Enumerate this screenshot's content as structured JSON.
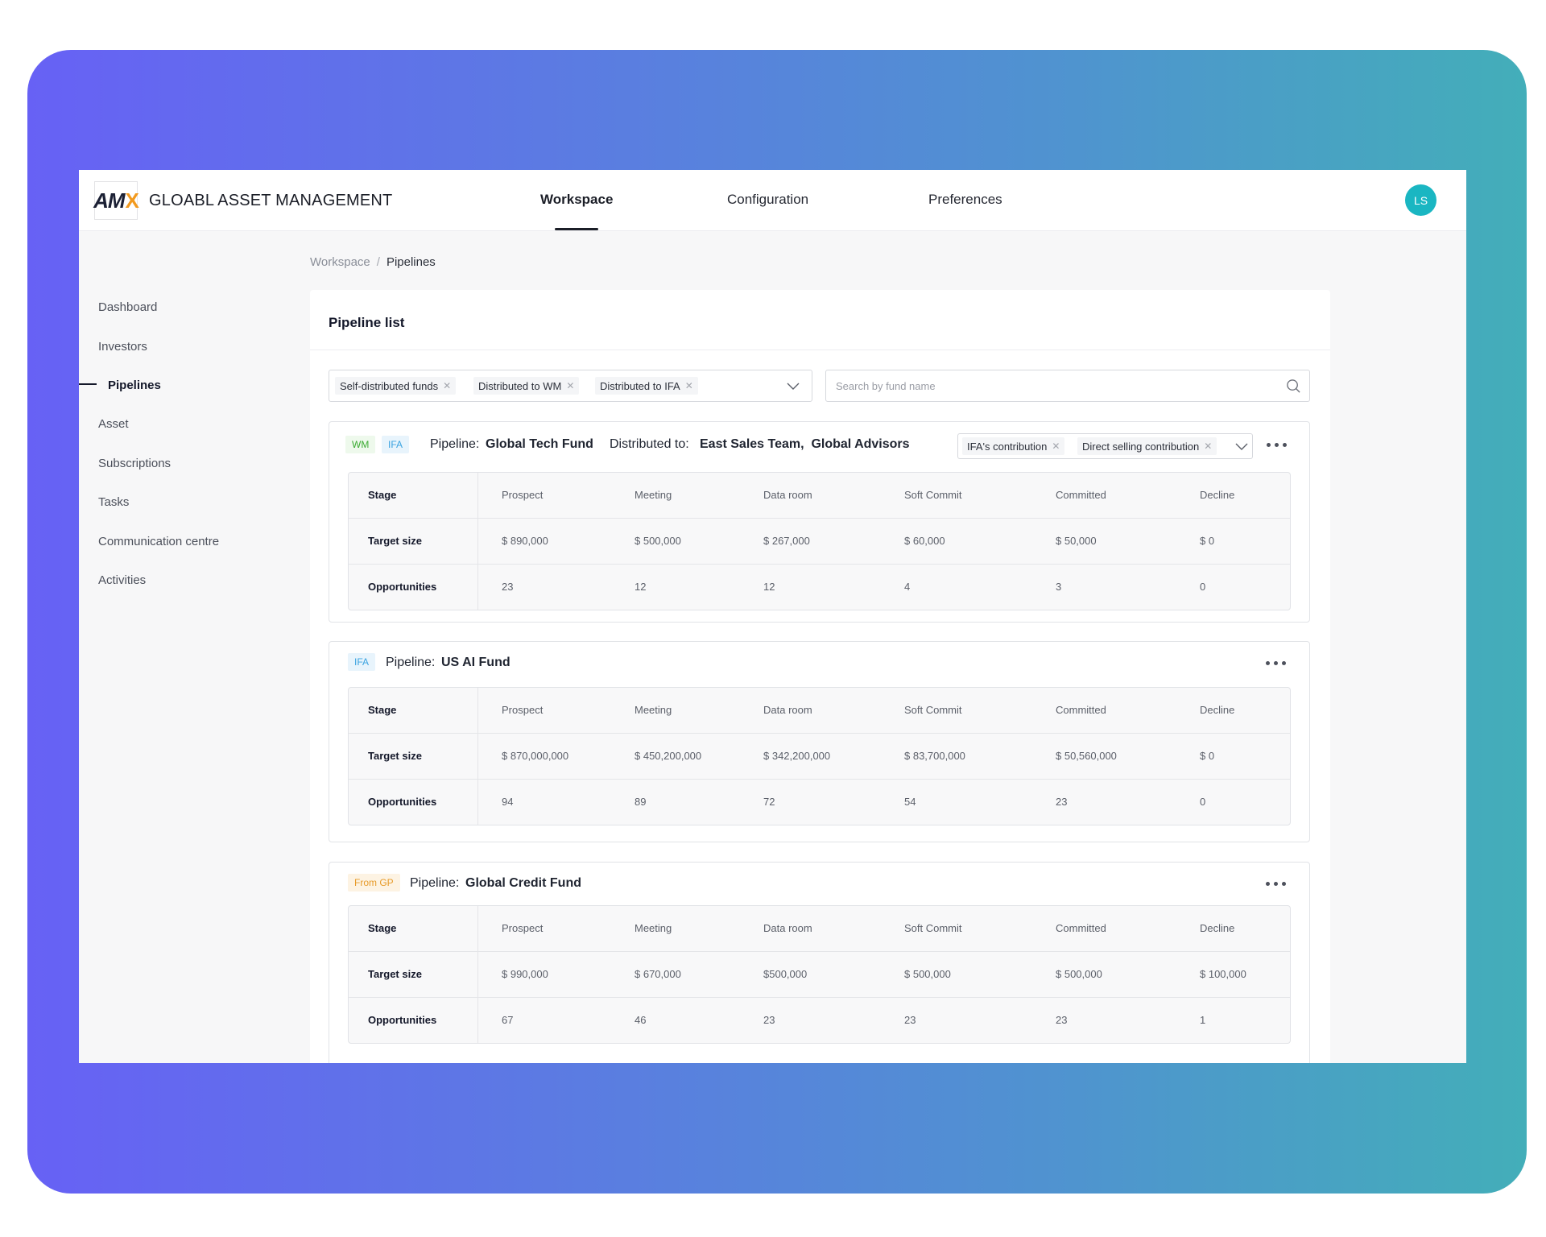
{
  "app": {
    "brand": "GLOABL ASSET MANAGEMENT",
    "logo_text": "AM",
    "logo_accent": "X",
    "avatar_initials": "LS"
  },
  "nav": {
    "tabs": [
      {
        "label": "Workspace",
        "active": true
      },
      {
        "label": "Configuration",
        "active": false
      },
      {
        "label": "Preferences",
        "active": false
      }
    ]
  },
  "sidebar": {
    "items": [
      {
        "label": "Dashboard"
      },
      {
        "label": "Investors"
      },
      {
        "label": "Pipelines",
        "active": true
      },
      {
        "label": "Asset"
      },
      {
        "label": "Subscriptions"
      },
      {
        "label": "Tasks"
      },
      {
        "label": "Communication centre"
      },
      {
        "label": "Activities"
      }
    ]
  },
  "breadcrumb": {
    "root": "Workspace",
    "separator": "/",
    "current": "Pipelines"
  },
  "main": {
    "title": "Pipeline list",
    "filters": {
      "chips": [
        "Self-distributed funds",
        "Distributed to WM",
        "Distributed to IFA"
      ]
    },
    "search": {
      "placeholder": "Search by fund name",
      "value": ""
    }
  },
  "pipelines": [
    {
      "tags": [
        "WM",
        "IFA"
      ],
      "pipeline_label": "Pipeline:",
      "name": "Global Tech Fund",
      "distributed_label": "Distributed to:",
      "distributed_to": "East Sales Team,  Global Advisors",
      "contribution_chips": [
        "IFA's contribution",
        "Direct selling contribution"
      ],
      "table": {
        "header": [
          "Stage",
          "Prospect",
          "Meeting",
          "Data room",
          "Soft Commit",
          "Committed",
          "Decline"
        ],
        "rows": [
          [
            "Target size",
            "$ 890,000",
            "$ 500,000",
            "$ 267,000",
            "$ 60,000",
            "$ 50,000",
            "$ 0"
          ],
          [
            "Opportunities",
            "23",
            "12",
            "12",
            "4",
            "3",
            "0"
          ]
        ]
      }
    },
    {
      "tags": [
        "IFA"
      ],
      "pipeline_label": "Pipeline:",
      "name": "US AI Fund",
      "table": {
        "header": [
          "Stage",
          "Prospect",
          "Meeting",
          "Data room",
          "Soft Commit",
          "Committed",
          "Decline"
        ],
        "rows": [
          [
            "Target size",
            "$ 870,000,000",
            "$ 450,200,000",
            "$ 342,200,000",
            "$ 83,700,000",
            "$ 50,560,000",
            "$ 0"
          ],
          [
            "Opportunities",
            "94",
            "89",
            "72",
            "54",
            "23",
            "0"
          ]
        ]
      }
    },
    {
      "tags": [
        "From GP"
      ],
      "pipeline_label": "Pipeline:",
      "name": "Global Credit Fund",
      "table": {
        "header": [
          "Stage",
          "Prospect",
          "Meeting",
          "Data room",
          "Soft Commit",
          "Committed",
          "Decline"
        ],
        "rows": [
          [
            "Target size",
            "$ 990,000",
            "$ 670,000",
            "$500,000",
            "$ 500,000",
            "$ 500,000",
            "$ 100,000"
          ],
          [
            "Opportunities",
            "67",
            "46",
            "23",
            "23",
            "23",
            "1"
          ]
        ]
      }
    }
  ],
  "colors": {
    "frame_gradient_start": "#6761f5",
    "frame_gradient_end": "#43aeb9",
    "avatar": "#1ab6c2",
    "tag_wm": "#3bab32",
    "tag_ifa": "#3aa3e0",
    "tag_gp": "#e79b2a"
  }
}
